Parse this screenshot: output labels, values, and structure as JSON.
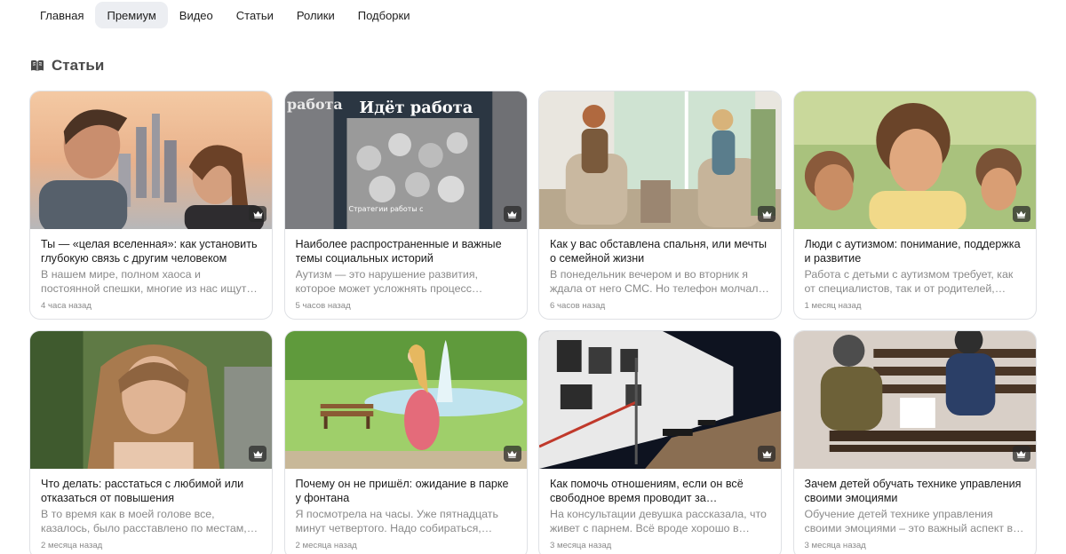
{
  "nav": {
    "items": [
      {
        "label": "Главная",
        "active": false
      },
      {
        "label": "Премиум",
        "active": true
      },
      {
        "label": "Видео",
        "active": false
      },
      {
        "label": "Статьи",
        "active": false
      },
      {
        "label": "Ролики",
        "active": false
      },
      {
        "label": "Подборки",
        "active": false
      }
    ]
  },
  "section": {
    "title": "Статьи",
    "icon": "open-book-icon"
  },
  "badge_icon": "crown-icon",
  "cards": [
    {
      "title": "Ты — «целая вселенная»: как установить глубокую связь с другим человеком",
      "excerpt": "В нашем мире, полном хаоса и постоянной спешки, многие из нас ищут…",
      "time": "4 часа назад",
      "image": "couple-city-sunset"
    },
    {
      "title": "Наиболее распространенные и важные темы социальных историй",
      "excerpt": "Аутизм — это нарушение развития, которое может усложнять процесс…",
      "time": "5 часов назад",
      "image": "book-cover-children",
      "image_text": [
        "Идёт работа",
        "работа",
        "Стратегии работы с"
      ]
    },
    {
      "title": "Как у вас обставлена спальня, или мечты о семейной жизни",
      "excerpt": "В понедельник вечером и во вторник я ждала от него СМС. Но телефон молчал…",
      "time": "6 часов назад",
      "image": "therapy-session"
    },
    {
      "title": "Люди с аутизмом: понимание, поддержка и развитие",
      "excerpt": "Работа с детьми с аутизмом требует, как от специалистов, так и от родителей,…",
      "time": "1 месяц назад",
      "image": "smiling-children"
    },
    {
      "title": "Что делать: расстаться с любимой или отказаться от повышения",
      "excerpt": "В то время как в моей голове все, казалось, было расставлено по местам,…",
      "time": "2 месяца назад",
      "image": "woman-portrait"
    },
    {
      "title": "Почему он не пришёл: ожидание в парке у фонтана",
      "excerpt": "Я посмотрела на часы. Уже пятнадцать минут четвертого. Надо собираться,…",
      "time": "2 месяца назад",
      "image": "park-fountain"
    },
    {
      "title": "Как помочь отношениям, если он всё свободное время проводит за…",
      "excerpt": "На консультации девушка рассказала, что живет с парнем. Всё вроде хорошо в…",
      "time": "3 месяца назад",
      "image": "photo-exhibition"
    },
    {
      "title": "Зачем детей обучать технике управления своими эмоциями",
      "excerpt": "Обучение детей технике управления своими эмоциями – это важный аспект в…",
      "time": "3 месяца назад",
      "image": "kids-on-bench"
    }
  ]
}
